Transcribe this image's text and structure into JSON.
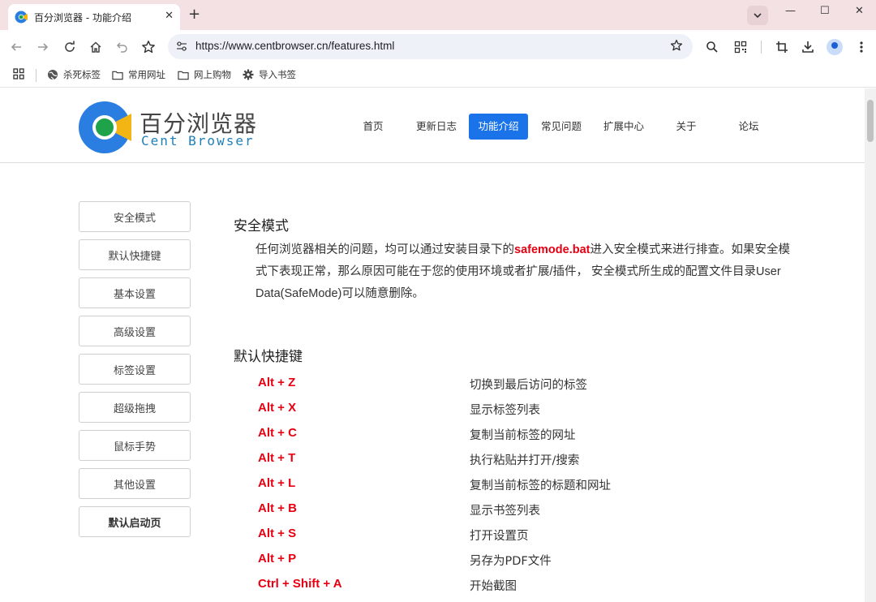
{
  "browser": {
    "tab_title": "百分浏览器 - 功能介绍",
    "tab_close": "✕",
    "new_tab": "+",
    "url": "https://www.centbrowser.cn/features.html",
    "win_minimize": "—",
    "win_maximize": "☐",
    "win_close": "✕"
  },
  "bookmarks": [
    {
      "label": "杀死标签",
      "icon": "globe-icon"
    },
    {
      "label": "常用网址",
      "icon": "folder-icon"
    },
    {
      "label": "网上购物",
      "icon": "folder-icon"
    },
    {
      "label": "导入书签",
      "icon": "gear-icon"
    }
  ],
  "site": {
    "logo_cn": "百分浏览器",
    "logo_en": "Cent Browser",
    "nav": [
      {
        "label": "首页"
      },
      {
        "label": "更新日志"
      },
      {
        "label": "功能介绍",
        "active": true
      },
      {
        "label": "常见问题"
      },
      {
        "label": "扩展中心"
      },
      {
        "label": "关于"
      },
      {
        "label": "论坛"
      }
    ],
    "sidebar": [
      {
        "label": "安全模式"
      },
      {
        "label": "默认快捷键"
      },
      {
        "label": "基本设置"
      },
      {
        "label": "高级设置"
      },
      {
        "label": "标签设置"
      },
      {
        "label": "超级拖拽"
      },
      {
        "label": "鼠标手势"
      },
      {
        "label": "其他设置"
      },
      {
        "label": "默认启动页",
        "bold": true
      }
    ]
  },
  "content": {
    "safe_mode": {
      "title": "安全模式",
      "text_before": "任何浏览器相关的问题，均可以通过安装目录下的",
      "highlight": "safemode.bat",
      "text_after": "进入安全模式来进行排查。如果安全模式下表现正常，那么原因可能在于您的使用环境或者扩展/插件， 安全模式所生成的配置文件目录User Data(SafeMode)可以随意删除。"
    },
    "shortcuts": {
      "title": "默认快捷键",
      "items": [
        {
          "keys": "Alt + Z",
          "desc": "切换到最后访问的标签"
        },
        {
          "keys": "Alt + X",
          "desc": "显示标签列表"
        },
        {
          "keys": "Alt + C",
          "desc": "复制当前标签的网址"
        },
        {
          "keys": "Alt + T",
          "desc": "执行粘贴并打开/搜索"
        },
        {
          "keys": "Alt + L",
          "desc": "复制当前标签的标题和网址"
        },
        {
          "keys": "Alt + B",
          "desc": "显示书签列表"
        },
        {
          "keys": "Alt + S",
          "desc": "打开设置页"
        },
        {
          "keys": "Alt + P",
          "desc": "另存为PDF文件"
        },
        {
          "keys": "Ctrl + Shift + A",
          "desc": "开始截图"
        }
      ]
    }
  },
  "colors": {
    "accent": "#1a73e8",
    "highlight_red": "#e60012",
    "titlebar": "#f3e1e3"
  }
}
